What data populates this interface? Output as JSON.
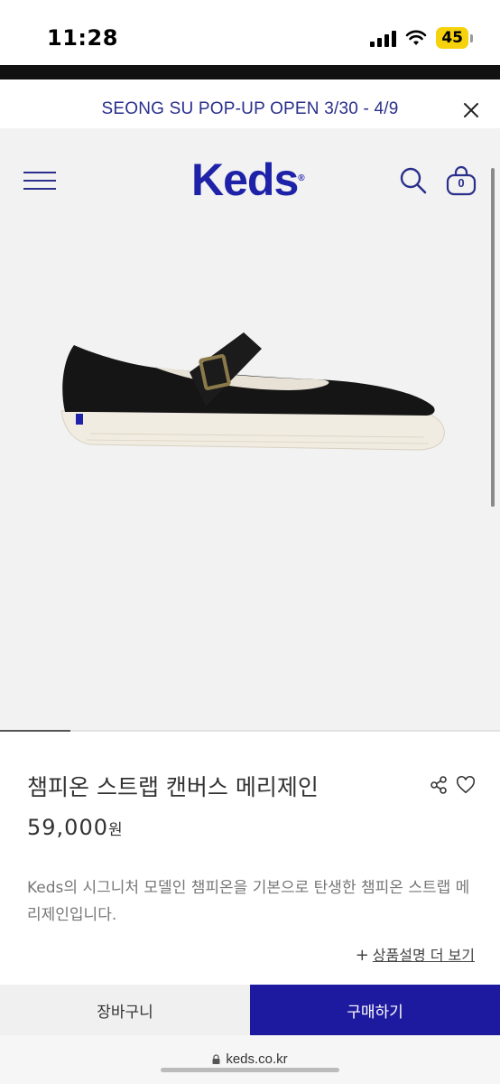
{
  "status_bar": {
    "time": "11:28",
    "battery": "45"
  },
  "promo": {
    "text": "SEONG SU POP-UP OPEN 3/30 - 4/9"
  },
  "header": {
    "logo": "Keds",
    "logo_mark": "®",
    "cart_count": "0",
    "brand_color": "#1e22a8"
  },
  "gallery": {
    "progress": 0.14
  },
  "product": {
    "title": "챔피온 스트랩 캔버스 메리제인",
    "price": "59,000",
    "price_unit": "원",
    "description": "Keds의 시그니처 모델인 챔피온을 기본으로 탄생한 챔피온 스트랩 메리제인입니다.",
    "more_label": "상품설명 더 보기"
  },
  "actions": {
    "cart_label": "장바구니",
    "buy_label": "구매하기",
    "buy_color": "#1e1aa0"
  },
  "browser": {
    "address": "keds.co.kr"
  }
}
